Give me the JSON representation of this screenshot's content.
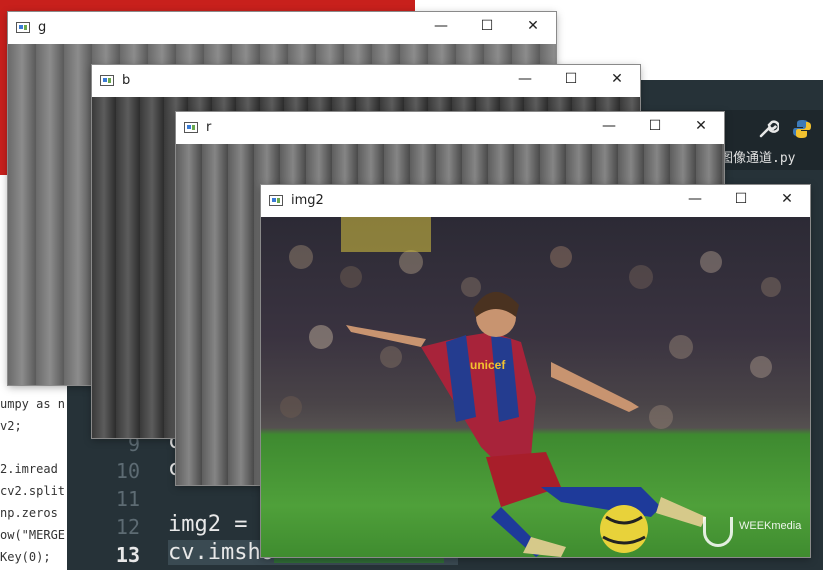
{
  "editor": {
    "tab_filename": "图像通道.py",
    "line_numbers": [
      "9",
      "10",
      "11",
      "12",
      "13"
    ],
    "current_line": "13",
    "code_lines": {
      "line_9": "c",
      "line_10": "c",
      "line_12": "img2 = ",
      "line_13": "cv.imsho"
    },
    "left_snippets": [
      "umpy as n",
      "v2;",
      "2.imread",
      "cv2.split",
      "np.zeros",
      "ow(\"MERGE",
      "Key(0);"
    ]
  },
  "windows": {
    "g": {
      "title": "g"
    },
    "b": {
      "title": "b"
    },
    "r": {
      "title": "r"
    },
    "img2": {
      "title": "img2"
    }
  },
  "controls": {
    "minimize": "—",
    "maximize": "☐",
    "close": "✕"
  },
  "photo": {
    "shirt_text": "unicef",
    "watermark": "WEEKmedia"
  },
  "icons": [
    "wrench-icon",
    "python-icon",
    "app-window-icon"
  ],
  "colors": {
    "red_bg": "#c8201c",
    "editor_bg": "#263238"
  }
}
